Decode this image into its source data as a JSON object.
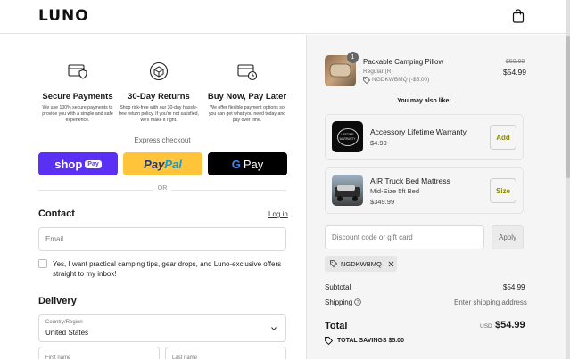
{
  "header": {
    "logo": "LUNO",
    "bag_icon": "shopping-bag-icon"
  },
  "features": [
    {
      "icon": "credit-card-shield-icon",
      "title": "Secure Payments",
      "text": "We use 100% secure payments to provide you with a simple and safe experience."
    },
    {
      "icon": "return-box-icon",
      "title": "30-Day Returns",
      "text": "Shop risk-free with our 30-day hassle-free return policy. If you're not satisfied, we'll make it right."
    },
    {
      "icon": "card-clock-icon",
      "title": "Buy Now, Pay Later",
      "text": "We offer flexible payment options so you can get what you need today and pay over time."
    }
  ],
  "express": {
    "label": "Express checkout",
    "shop_pay": {
      "word": "shop",
      "pill": "Pay"
    },
    "paypal": {
      "pay": "Pay",
      "pal": "Pal"
    },
    "gpay": {
      "g": "G",
      "pay": "Pay"
    },
    "or": "OR"
  },
  "contact": {
    "title": "Contact",
    "login": "Log in",
    "email_placeholder": "Email",
    "newsletter": "Yes, I want practical camping tips, gear drops, and Luno-exclusive offers straight to my inbox!"
  },
  "delivery": {
    "title": "Delivery",
    "country_label": "Country/Region",
    "country_value": "United States",
    "first_name_placeholder": "First name",
    "last_name_placeholder": "Last name"
  },
  "cart": {
    "item": {
      "qty": "1",
      "name": "Packable Camping Pillow",
      "variant": "Regular (R)",
      "discount": "NGDKWBMQ (-$5.00)",
      "compare_price": "$59.99",
      "price": "$54.99"
    },
    "upsell_title": "You may also like:",
    "upsells": [
      {
        "name": "Accessory Lifetime Warranty",
        "sub": "",
        "price": "$4.99",
        "button": "Add",
        "thumb_text": "LIFETIME WARRANTY"
      },
      {
        "name": "AIR Truck Bed Mattress",
        "sub": "Mid-Size 5ft Bed",
        "price": "$349.99",
        "button": "Size"
      }
    ],
    "discount_placeholder": "Discount code or gift card",
    "apply": "Apply",
    "applied_code": "NGDKWBMQ",
    "subtotal_label": "Subtotal",
    "subtotal_value": "$54.99",
    "shipping_label": "Shipping",
    "shipping_value": "Enter shipping address",
    "total_label": "Total",
    "currency": "USD",
    "total_value": "$54.99",
    "savings_label": "TOTAL SAVINGS",
    "savings_value": "$5.00"
  },
  "colors": {
    "shop_pay": "#5a31f4",
    "paypal": "#ffc439",
    "gpay": "#000000",
    "accent_button_text": "#8a8a00"
  }
}
